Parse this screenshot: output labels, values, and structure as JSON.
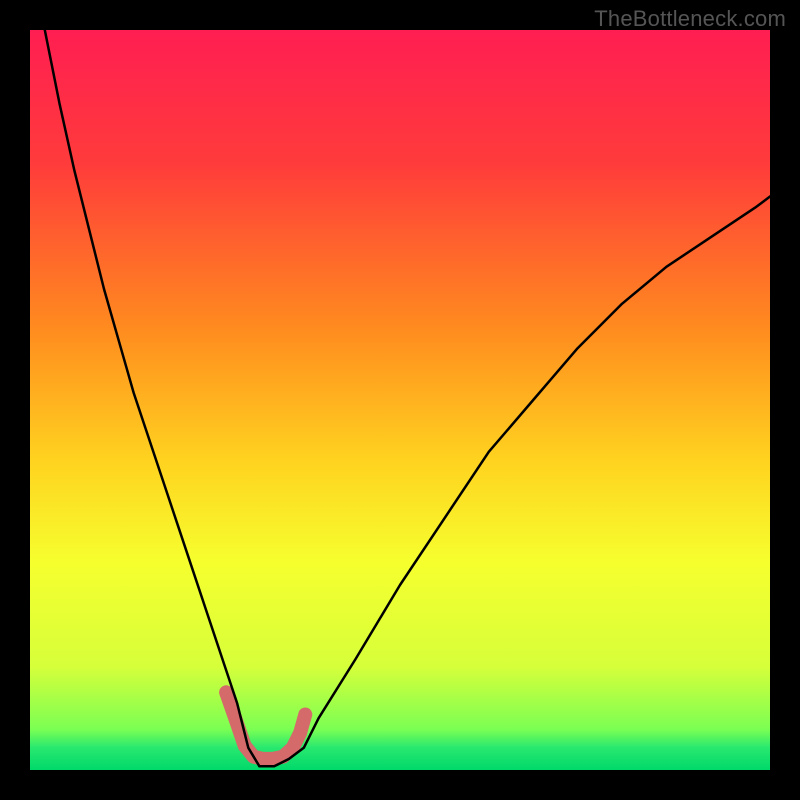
{
  "watermark": {
    "text": "TheBottleneck.com"
  },
  "frame": {
    "bg": "#000000",
    "inner_x": 30,
    "inner_y": 30,
    "inner_w": 740,
    "inner_h": 740
  },
  "gradient": {
    "stops": [
      {
        "offset": 0.0,
        "color": "#ff1e52"
      },
      {
        "offset": 0.18,
        "color": "#ff3b3b"
      },
      {
        "offset": 0.4,
        "color": "#ff8a1f"
      },
      {
        "offset": 0.58,
        "color": "#ffd21f"
      },
      {
        "offset": 0.72,
        "color": "#f6ff2e"
      },
      {
        "offset": 0.86,
        "color": "#d6ff3a"
      },
      {
        "offset": 0.945,
        "color": "#7bff53"
      },
      {
        "offset": 0.97,
        "color": "#28e86f"
      },
      {
        "offset": 1.0,
        "color": "#00d96a"
      }
    ]
  },
  "chart_data": {
    "type": "line",
    "title": "",
    "xlabel": "",
    "ylabel": "",
    "xlim": [
      0,
      100
    ],
    "ylim": [
      0,
      100
    ],
    "series": [
      {
        "name": "bottleneck-curve",
        "stroke": "#000000",
        "stroke_width": 2.5,
        "x": [
          2,
          4,
          6,
          8,
          10,
          12,
          14,
          16,
          18,
          20,
          22,
          24,
          26,
          28,
          29.5,
          31,
          33,
          35,
          37,
          39,
          44,
          50,
          56,
          62,
          68,
          74,
          80,
          86,
          92,
          98,
          100
        ],
        "values": [
          100,
          90,
          81,
          73,
          65,
          58,
          51,
          45,
          39,
          33,
          27,
          21,
          15,
          9,
          3,
          0.5,
          0.5,
          1.5,
          3,
          7,
          15,
          25,
          34,
          43,
          50,
          57,
          63,
          68,
          72,
          76,
          77.5
        ]
      }
    ],
    "highlight": {
      "name": "green-band-highlight",
      "stroke": "#d46a6a",
      "stroke_width": 14,
      "linecap": "round",
      "x": [
        26.5,
        27.8,
        29.0,
        30.2,
        31.5,
        32.8,
        34.2,
        35.5,
        36.5,
        37.2
      ],
      "values": [
        10.5,
        6.8,
        3.3,
        1.8,
        1.5,
        1.5,
        1.8,
        3.0,
        5.0,
        7.5
      ]
    }
  }
}
